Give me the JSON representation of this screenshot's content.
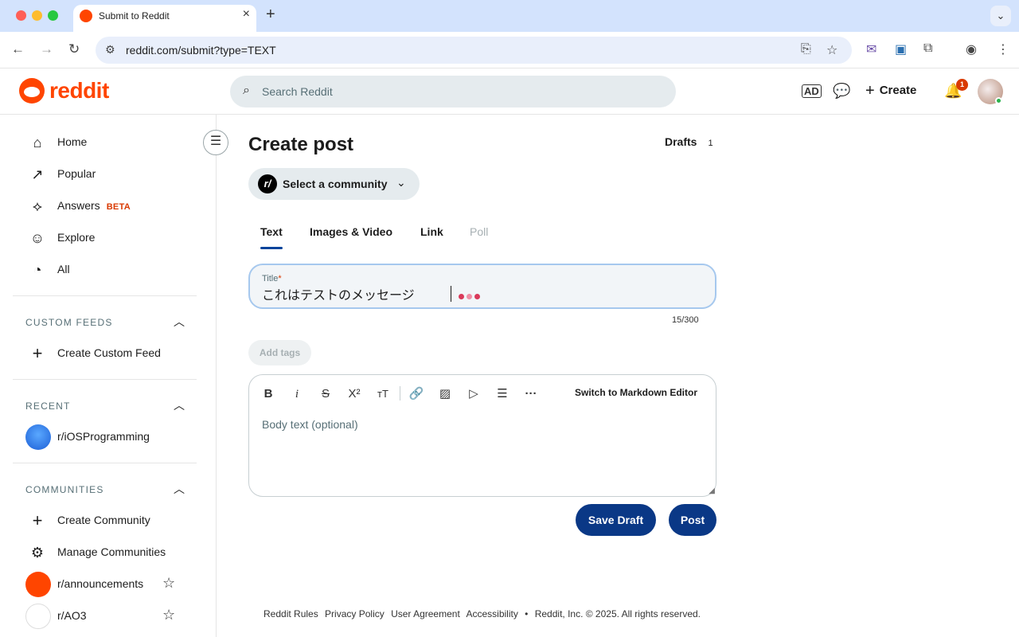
{
  "browser": {
    "tab_title": "Submit to Reddit",
    "url": "reddit.com/submit?type=TEXT"
  },
  "header": {
    "logo_text": "reddit",
    "search_placeholder": "Search Reddit",
    "create_label": "Create",
    "notification_count": "1"
  },
  "sidebar": {
    "nav": [
      {
        "label": "Home"
      },
      {
        "label": "Popular"
      },
      {
        "label": "Answers",
        "badge": "BETA"
      },
      {
        "label": "Explore"
      },
      {
        "label": "All"
      }
    ],
    "custom_feeds": {
      "title": "CUSTOM FEEDS",
      "create_label": "Create Custom Feed"
    },
    "recent": {
      "title": "RECENT",
      "items": [
        {
          "label": "r/iOSProgramming"
        }
      ]
    },
    "communities": {
      "title": "COMMUNITIES",
      "create_label": "Create Community",
      "manage_label": "Manage Communities",
      "items": [
        {
          "label": "r/announcements"
        },
        {
          "label": "r/AO3"
        }
      ]
    }
  },
  "main": {
    "page_title": "Create post",
    "drafts_label": "Drafts",
    "drafts_count": "1",
    "community_badge": "r/",
    "community_label": "Select a community",
    "tabs": [
      {
        "label": "Text",
        "active": true
      },
      {
        "label": "Images & Video"
      },
      {
        "label": "Link"
      },
      {
        "label": "Poll",
        "disabled": true
      }
    ],
    "title_field": {
      "label": "Title",
      "required_marker": "*",
      "value": "これはテストのメッセージ",
      "char_count": "15/300"
    },
    "add_tags_label": "Add tags",
    "editor": {
      "switch_label": "Switch to Markdown Editor",
      "body_placeholder": "Body text (optional)"
    },
    "save_draft_label": "Save Draft",
    "post_label": "Post"
  },
  "footer": {
    "links": [
      "Reddit Rules",
      "Privacy Policy",
      "User Agreement",
      "Accessibility"
    ],
    "separator": "•",
    "copyright": "Reddit, Inc. © 2025. All rights reserved."
  },
  "colors": {
    "brand": "#ff4500",
    "primary_button": "#0a3886",
    "tab_underline": "#0a449b",
    "typing_dots": [
      "#d93a5a",
      "#f08fa5",
      "#d93a5a"
    ]
  }
}
